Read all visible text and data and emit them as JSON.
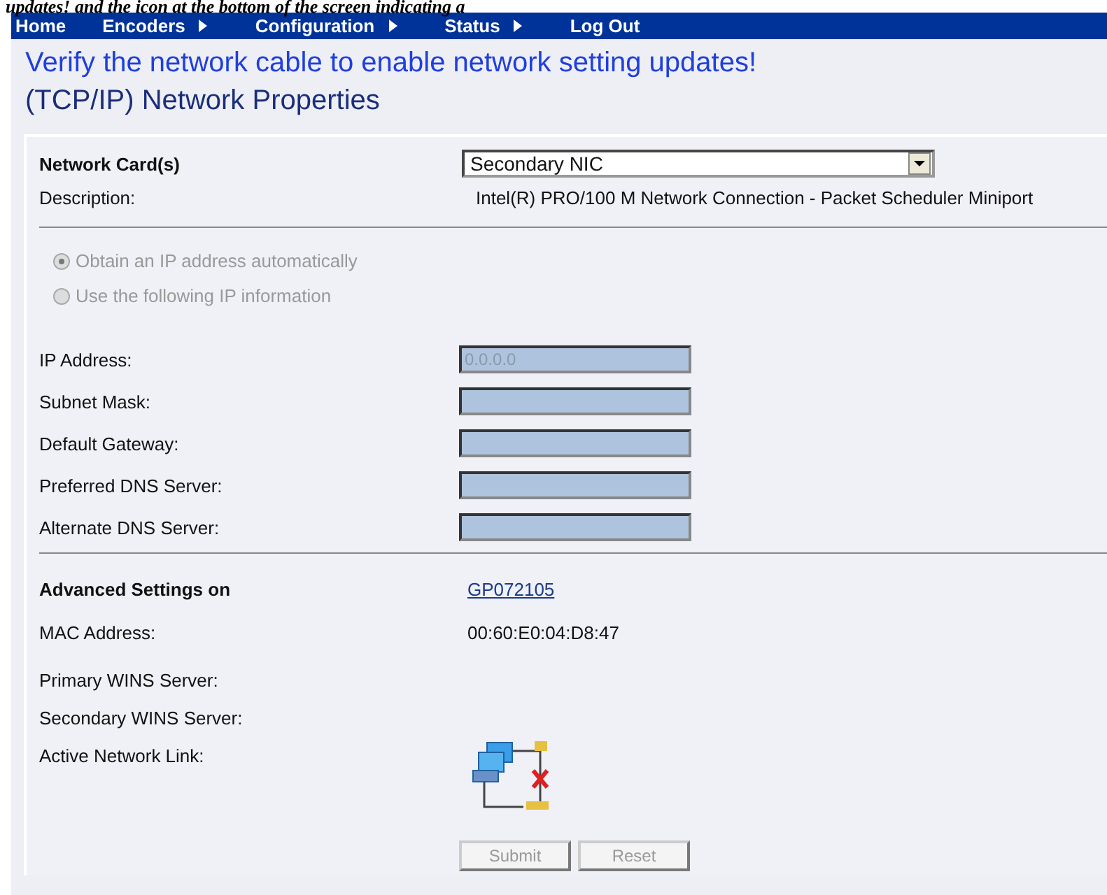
{
  "caption": "updates! and the icon at the bottom of the screen indicating a",
  "nav": [
    {
      "label": "Home",
      "submenu": false
    },
    {
      "label": "Encoders",
      "submenu": true
    },
    {
      "label": "Configuration",
      "submenu": true
    },
    {
      "label": "Status",
      "submenu": true
    },
    {
      "label": "Log Out",
      "submenu": false
    }
  ],
  "alert": "Verify the network cable to enable network setting updates!",
  "heading": "(TCP/IP) Network Properties",
  "network_card": {
    "label": "Network Card(s)",
    "value": "Secondary NIC"
  },
  "description": {
    "label": "Description:",
    "value": "Intel(R) PRO/100 M Network Connection - Packet Scheduler Miniport"
  },
  "ip_options": [
    {
      "label": "Obtain an IP address automatically",
      "selected": true,
      "disabled": true
    },
    {
      "label": "Use the following IP information",
      "selected": false,
      "disabled": true
    }
  ],
  "ip_fields": [
    {
      "label": "IP Address:",
      "value": "0.0.0.0"
    },
    {
      "label": "Subnet Mask:"
    },
    {
      "label": "Default Gateway:"
    },
    {
      "label": "Preferred DNS Server:"
    },
    {
      "label": "Alternate DNS Server:"
    }
  ],
  "advanced": {
    "label": "Advanced Settings on",
    "link": "GP072105"
  },
  "info": [
    {
      "label": "MAC Address:",
      "value": "00:60:E0:04:D8:47"
    },
    {
      "label": "Primary WINS Server:"
    },
    {
      "label": "Secondary WINS Server:"
    }
  ],
  "network_link": {
    "label": "Active Network Link:",
    "connected": false
  },
  "buttons": [
    {
      "label": "Submit",
      "disabled": true
    },
    {
      "label": "Reset",
      "disabled": true
    }
  ]
}
